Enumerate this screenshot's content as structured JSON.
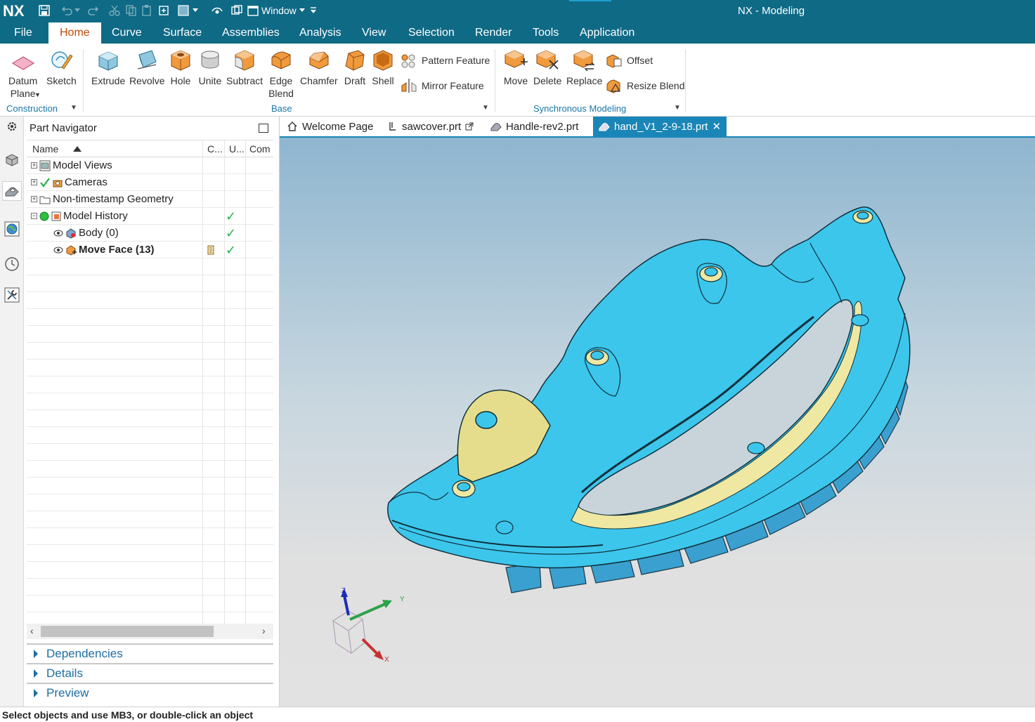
{
  "app": {
    "logo": "NX",
    "title": "NX - Modeling",
    "window_menu_label": "Window"
  },
  "menu": {
    "tabs": [
      {
        "label": "File"
      },
      {
        "label": "Home"
      },
      {
        "label": "Curve"
      },
      {
        "label": "Surface"
      },
      {
        "label": "Assemblies"
      },
      {
        "label": "Analysis"
      },
      {
        "label": "View"
      },
      {
        "label": "Selection"
      },
      {
        "label": "Render"
      },
      {
        "label": "Tools"
      },
      {
        "label": "Application"
      }
    ],
    "active_tab": "Home"
  },
  "ribbon": {
    "construction": {
      "group_label": "Construction",
      "datum_plane": "Datum\nPlane",
      "sketch": "Sketch"
    },
    "base": {
      "group_label": "Base",
      "extrude": "Extrude",
      "revolve": "Revolve",
      "hole": "Hole",
      "unite": "Unite",
      "subtract": "Subtract",
      "edge_blend": "Edge\nBlend",
      "chamfer": "Chamfer",
      "draft": "Draft",
      "shell": "Shell",
      "pattern_feature": "Pattern Feature",
      "mirror_feature": "Mirror Feature"
    },
    "sync": {
      "group_label": "Synchronous Modeling",
      "move": "Move",
      "delete": "Delete",
      "replace": "Replace",
      "offset": "Offset",
      "resize_blend": "Resize Blend"
    }
  },
  "navigator": {
    "title": "Part Navigator",
    "columns": {
      "name": "Name",
      "c": "C...",
      "u": "U...",
      "com": "Com"
    },
    "rows": [
      {
        "label": "Model Views",
        "bold": false
      },
      {
        "label": "Cameras",
        "bold": false
      },
      {
        "label": "Non-timestamp Geometry",
        "bold": false
      },
      {
        "label": "Model History",
        "bold": false
      },
      {
        "label": "Body (0)",
        "bold": false
      },
      {
        "label": "Move Face (13)",
        "bold": true
      }
    ],
    "sections": [
      "Dependencies",
      "Details",
      "Preview"
    ]
  },
  "doc_tabs": [
    {
      "label": "Welcome Page"
    },
    {
      "label": "sawcover.prt"
    },
    {
      "label": "Handle-rev2.prt"
    },
    {
      "label": "hand_V1_2-9-18.prt",
      "active": true
    }
  ],
  "triad": {
    "x_label": "X",
    "y_label": "Y",
    "z_label": "Z"
  },
  "status": {
    "message": "Select objects and use MB3, or double-click an object"
  },
  "colors": {
    "titlebar": "#0f6a86",
    "accent_tab_text": "#c14a0a",
    "model_body": "#3cc6ec",
    "model_highlight": "#efe8a2",
    "group_label": "#1877a8",
    "active_doc_tab": "#1a86b8"
  }
}
